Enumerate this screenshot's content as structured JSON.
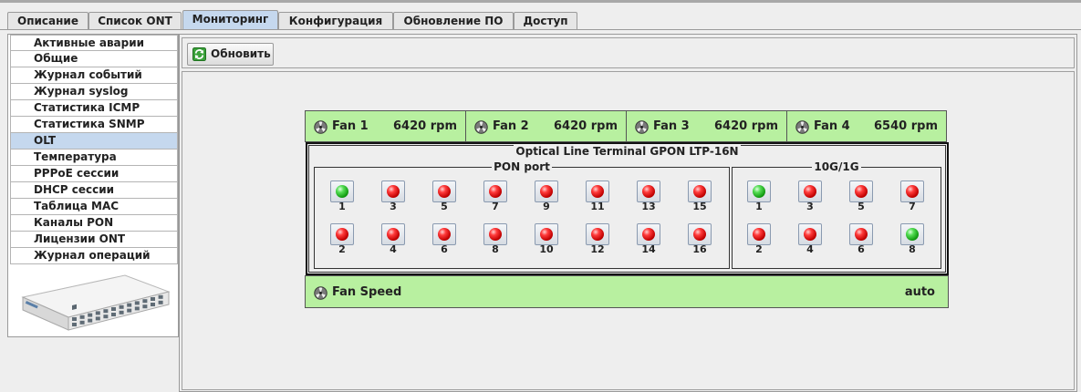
{
  "tabs": [
    {
      "label": "Описание"
    },
    {
      "label": "Список ONT"
    },
    {
      "label": "Мониторинг"
    },
    {
      "label": "Конфигурация"
    },
    {
      "label": "Обновление ПО"
    },
    {
      "label": "Доступ"
    }
  ],
  "active_tab": "Мониторинг",
  "sidebar": {
    "items": [
      {
        "label": "Активные аварии"
      },
      {
        "label": "Общие"
      },
      {
        "label": "Журнал событий"
      },
      {
        "label": "Журнал syslog"
      },
      {
        "label": "Статистика ICMP"
      },
      {
        "label": "Статистика SNMP"
      },
      {
        "label": "OLT"
      },
      {
        "label": "Температура"
      },
      {
        "label": "PPPoE сессии"
      },
      {
        "label": "DHCP сессии"
      },
      {
        "label": "Таблица MAC"
      },
      {
        "label": "Каналы PON"
      },
      {
        "label": "Лицензии ONT"
      },
      {
        "label": "Журнал операций"
      }
    ],
    "selected": "OLT",
    "device_image_icon": "olt-device-image"
  },
  "toolbar": {
    "refresh_label": "Обновить",
    "refresh_icon": "refresh-icon"
  },
  "fans": [
    {
      "name": "Fan 1",
      "rpm": "6420 rpm"
    },
    {
      "name": "Fan 2",
      "rpm": "6420 rpm"
    },
    {
      "name": "Fan 3",
      "rpm": "6420 rpm"
    },
    {
      "name": "Fan 4",
      "rpm": "6540 rpm"
    }
  ],
  "olt": {
    "title": "Optical Line Terminal GPON LTP-16N",
    "pon": {
      "title": "PON port",
      "top": [
        {
          "num": "1",
          "status": "green"
        },
        {
          "num": "3",
          "status": "red"
        },
        {
          "num": "5",
          "status": "red"
        },
        {
          "num": "7",
          "status": "red"
        },
        {
          "num": "9",
          "status": "red"
        },
        {
          "num": "11",
          "status": "red"
        },
        {
          "num": "13",
          "status": "red"
        },
        {
          "num": "15",
          "status": "red"
        }
      ],
      "bottom": [
        {
          "num": "2",
          "status": "red"
        },
        {
          "num": "4",
          "status": "red"
        },
        {
          "num": "6",
          "status": "red"
        },
        {
          "num": "8",
          "status": "red"
        },
        {
          "num": "10",
          "status": "red"
        },
        {
          "num": "12",
          "status": "red"
        },
        {
          "num": "14",
          "status": "red"
        },
        {
          "num": "16",
          "status": "red"
        }
      ]
    },
    "uplink": {
      "title": "10G/1G",
      "top": [
        {
          "num": "1",
          "status": "green"
        },
        {
          "num": "3",
          "status": "red"
        },
        {
          "num": "5",
          "status": "red"
        },
        {
          "num": "7",
          "status": "red"
        }
      ],
      "bottom": [
        {
          "num": "2",
          "status": "red"
        },
        {
          "num": "4",
          "status": "red"
        },
        {
          "num": "6",
          "status": "red"
        },
        {
          "num": "8",
          "status": "green"
        }
      ]
    }
  },
  "fan_speed": {
    "label": "Fan Speed",
    "value": "auto"
  },
  "colors": {
    "fan_panel": "#b8f0a0",
    "selection": "#c5d8ee",
    "led_green": "#22bb22",
    "led_red": "#e01010"
  }
}
